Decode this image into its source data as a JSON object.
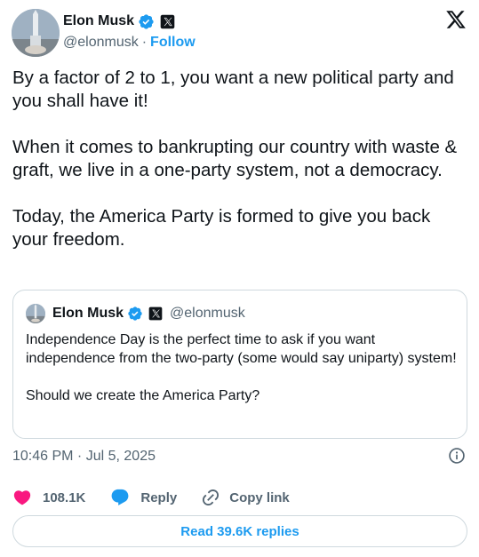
{
  "author": {
    "name": "Elon Musk",
    "handle": "@elonmusk",
    "separator": "·",
    "follow_label": "Follow"
  },
  "tweet": {
    "paragraphs": [
      "By a factor of 2 to 1, you want a new political party and you shall have it!",
      "When it comes to bankrupting our country with waste & graft, we live in a one-party system, not a democracy.",
      "Today, the America Party is formed to give you back your freedom."
    ]
  },
  "quoted": {
    "name": "Elon Musk",
    "handle": "@elonmusk",
    "paragraphs": [
      "Independence Day is the perfect time to ask if you want independence from the two-party (some would say uniparty) system!",
      "Should we create the America Party?"
    ]
  },
  "meta": {
    "timestamp": "10:46 PM · Jul 5, 2025"
  },
  "actions": {
    "like_count": "108.1K",
    "reply_label": "Reply",
    "copy_label": "Copy link"
  },
  "read_replies_label": "Read 39.6K replies",
  "icons": {
    "verified": "verified-badge-icon",
    "affiliate": "x-affiliate-badge-icon",
    "logo": "x-logo-icon",
    "info": "info-icon",
    "heart": "heart-icon",
    "reply": "reply-bubble-icon",
    "link": "link-icon"
  },
  "colors": {
    "accent": "#1d9bf0",
    "like": "#f91880",
    "secondary_text": "#536471",
    "border": "#cfd9de"
  }
}
